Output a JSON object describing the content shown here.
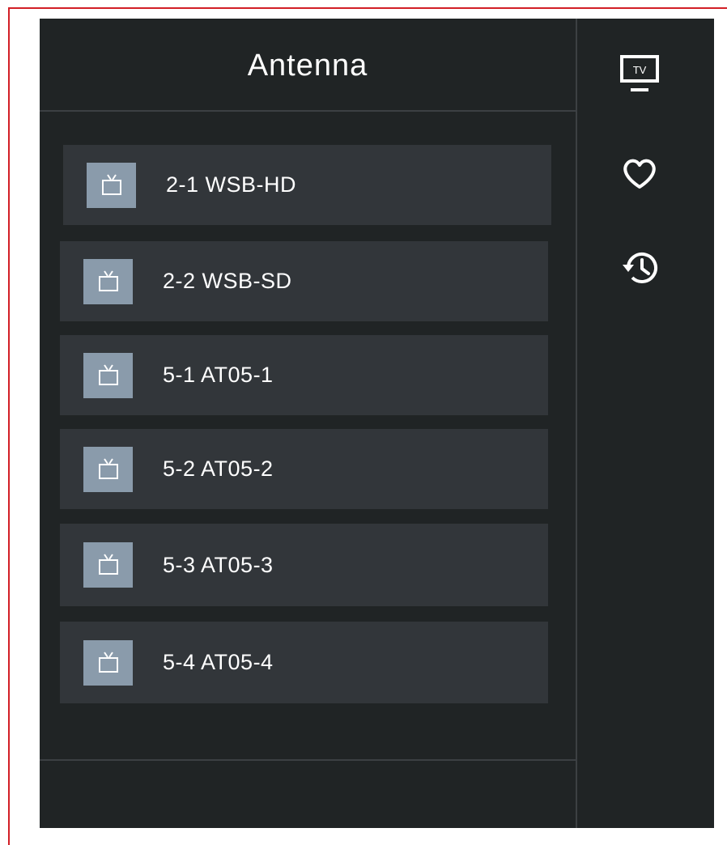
{
  "header": {
    "title": "Antenna"
  },
  "channels": [
    {
      "label": "2-1 WSB-HD",
      "icon": "tv-icon"
    },
    {
      "label": "2-2 WSB-SD",
      "icon": "tv-icon"
    },
    {
      "label": "5-1 AT05-1",
      "icon": "tv-icon"
    },
    {
      "label": "5-2 AT05-2",
      "icon": "tv-icon"
    },
    {
      "label": "5-3 AT05-3",
      "icon": "tv-icon"
    },
    {
      "label": "5-4 AT05-4",
      "icon": "tv-icon"
    }
  ],
  "sidebar": {
    "tv_icon_text": "TV",
    "items": [
      {
        "name": "tv-channels",
        "icon": "tv-icon"
      },
      {
        "name": "favorites",
        "icon": "heart-icon"
      },
      {
        "name": "history",
        "icon": "history-icon"
      }
    ]
  },
  "colors": {
    "frame_border": "#d21f26",
    "panel_bg": "#202425",
    "item_bg": "#32363a",
    "icon_bg": "#8a9bab",
    "text": "#ffffff"
  }
}
